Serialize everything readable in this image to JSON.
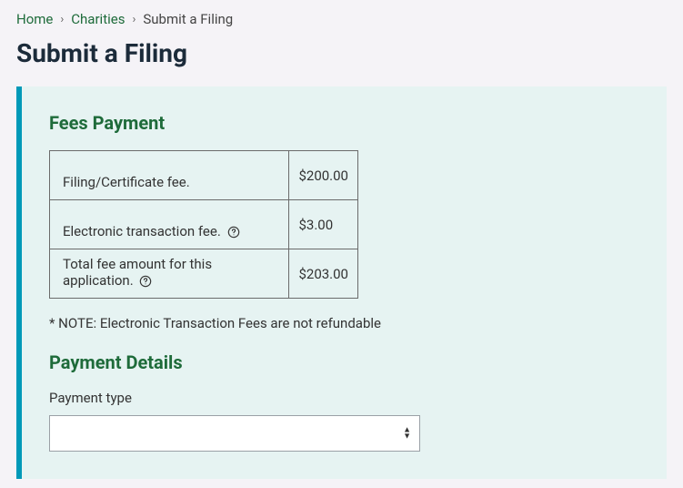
{
  "breadcrumb": {
    "home": "Home",
    "charities": "Charities",
    "current": "Submit a Filing"
  },
  "title": "Submit a Filing",
  "fees": {
    "heading": "Fees Payment",
    "rows": [
      {
        "label": "Filing/Certificate fee.",
        "amount": "$200.00",
        "help": false
      },
      {
        "label": "Electronic transaction fee.",
        "amount": "$3.00",
        "help": true
      },
      {
        "label": "Total fee amount for this application.",
        "amount": "$203.00",
        "help": true
      }
    ],
    "note": "* NOTE: Electronic Transaction Fees are not refundable"
  },
  "payment": {
    "heading": "Payment Details",
    "type_label": "Payment type",
    "type_value": ""
  }
}
